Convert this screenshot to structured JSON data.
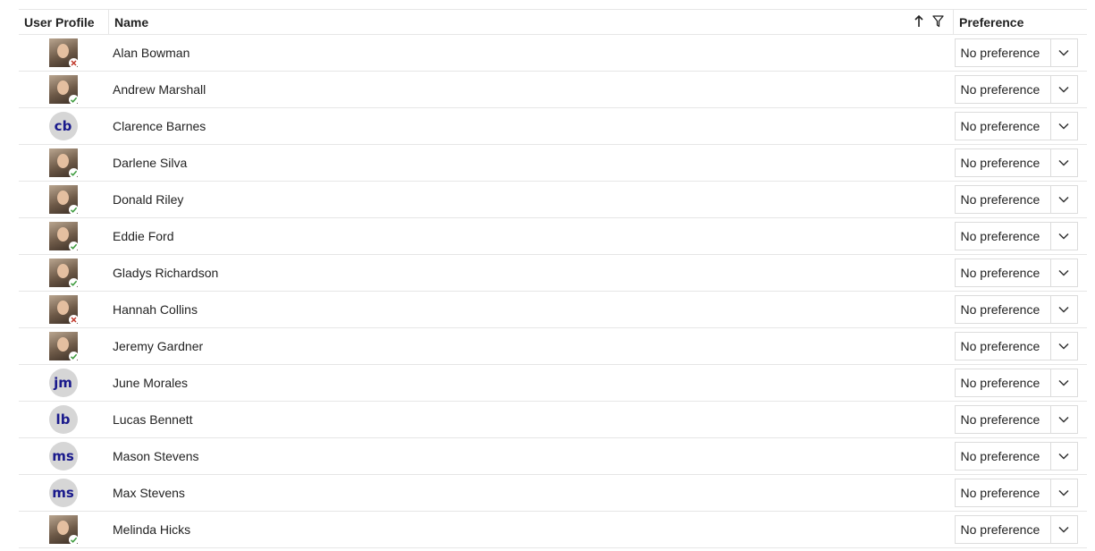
{
  "columns": {
    "profile": "User Profile",
    "name": "Name",
    "preference": "Preference"
  },
  "header_icons": [
    "sort-ascending-icon",
    "filter-icon"
  ],
  "colors": {
    "online": "#3c9a3c",
    "offline": "#c0392b",
    "initials_text": "#1a1a8c",
    "initials_bg": "#d6d6d6"
  },
  "users": [
    {
      "name": "Alan Bowman",
      "avatar": "photo",
      "status": "offline",
      "preference": "No preference"
    },
    {
      "name": "Andrew Marshall",
      "avatar": "photo",
      "status": "online",
      "preference": "No preference"
    },
    {
      "name": "Clarence Barnes",
      "avatar": "initials",
      "initials": "cb",
      "preference": "No preference"
    },
    {
      "name": "Darlene Silva",
      "avatar": "photo",
      "status": "online",
      "preference": "No preference"
    },
    {
      "name": "Donald Riley",
      "avatar": "photo",
      "status": "online",
      "preference": "No preference"
    },
    {
      "name": "Eddie Ford",
      "avatar": "photo",
      "status": "online",
      "preference": "No preference"
    },
    {
      "name": "Gladys Richardson",
      "avatar": "photo",
      "status": "online",
      "preference": "No preference"
    },
    {
      "name": "Hannah Collins",
      "avatar": "photo",
      "status": "offline",
      "preference": "No preference"
    },
    {
      "name": "Jeremy Gardner",
      "avatar": "photo",
      "status": "online",
      "preference": "No preference"
    },
    {
      "name": "June Morales",
      "avatar": "initials",
      "initials": "jm",
      "preference": "No preference"
    },
    {
      "name": "Lucas Bennett",
      "avatar": "initials",
      "initials": "lb",
      "preference": "No preference"
    },
    {
      "name": "Mason Stevens",
      "avatar": "initials",
      "initials": "ms",
      "preference": "No preference"
    },
    {
      "name": "Max Stevens",
      "avatar": "initials",
      "initials": "ms",
      "preference": "No preference"
    },
    {
      "name": "Melinda Hicks",
      "avatar": "photo",
      "status": "online",
      "preference": "No preference"
    }
  ]
}
